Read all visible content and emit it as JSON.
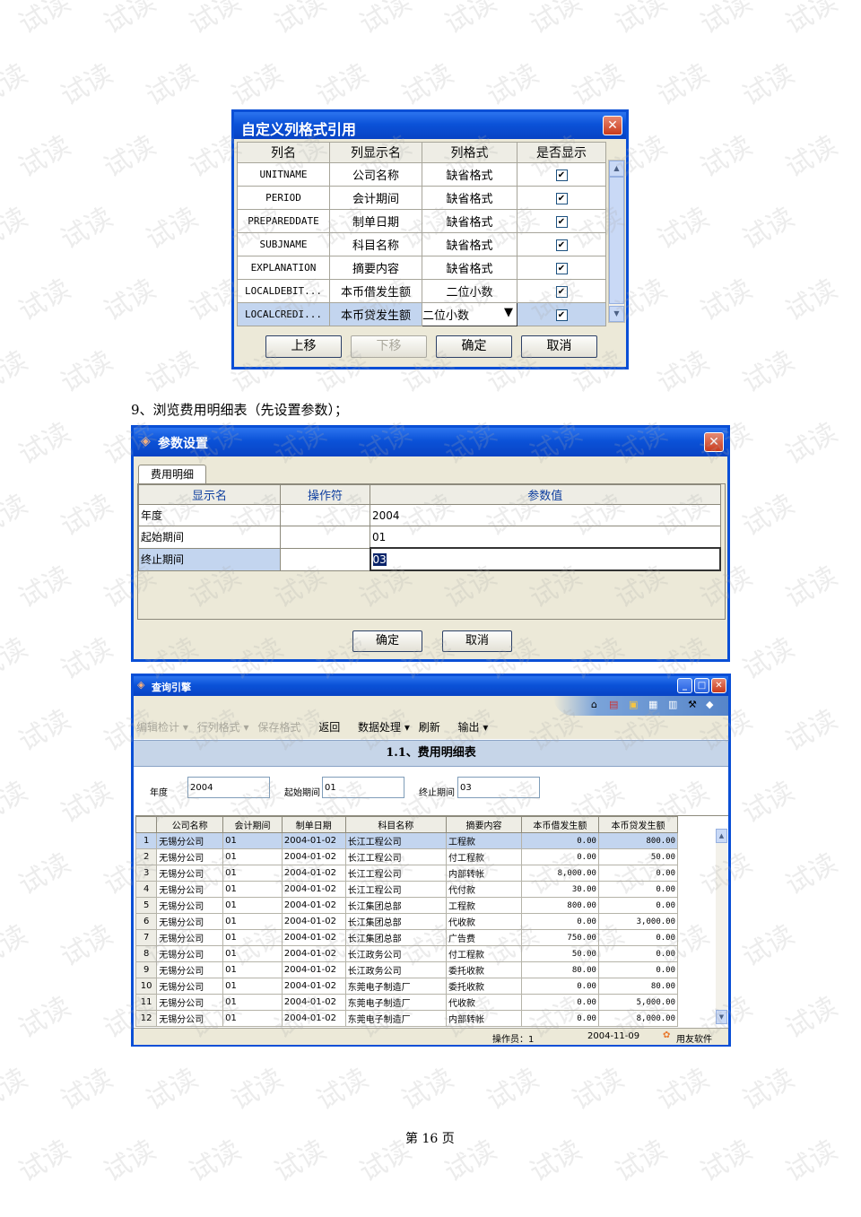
{
  "dialog1": {
    "title": "自定义列格式引用",
    "headers": [
      "列名",
      "列显示名",
      "列格式",
      "是否显示"
    ],
    "rows": [
      {
        "name": "UNITNAME",
        "display": "公司名称",
        "format": "缺省格式",
        "show": "✔"
      },
      {
        "name": "PERIOD",
        "display": "会计期间",
        "format": "缺省格式",
        "show": "✔"
      },
      {
        "name": "PREPAREDDATE",
        "display": "制单日期",
        "format": "缺省格式",
        "show": "✔"
      },
      {
        "name": "SUBJNAME",
        "display": "科目名称",
        "format": "缺省格式",
        "show": "✔"
      },
      {
        "name": "EXPLANATION",
        "display": "摘要内容",
        "format": "缺省格式",
        "show": "✔"
      },
      {
        "name": "LOCALDEBIT...",
        "display": "本币借发生额",
        "format": "二位小数",
        "show": "✔"
      },
      {
        "name": "LOCALCREDI...",
        "display": "本币贷发生额",
        "format": "二位小数",
        "show": "✔"
      }
    ],
    "buttons": {
      "up": "上移",
      "down": "下移",
      "ok": "确定",
      "cancel": "取消"
    }
  },
  "caption": "9、浏览费用明细表（先设置参数）；",
  "dialog2": {
    "title": "参数设置",
    "tab": "费用明细",
    "headers": [
      "显示名",
      "操作符",
      "参数值"
    ],
    "rows": [
      {
        "name": "年度",
        "op": "",
        "value": "2004"
      },
      {
        "name": "起始期间",
        "op": "",
        "value": "01"
      },
      {
        "name": "终止期间",
        "op": "",
        "value": "03"
      }
    ],
    "buttons": {
      "ok": "确定",
      "cancel": "取消"
    }
  },
  "query": {
    "title": "查询引擎",
    "menu": [
      "编辑检计 ▾",
      "行列格式 ▾",
      "保存格式",
      "返回",
      "数据处理 ▾",
      "刷新",
      "输出 ▾"
    ],
    "report_title": "1.1、费用明细表",
    "filters": {
      "year_label": "年度",
      "year": "2004",
      "start_label": "起始期间",
      "start": "01",
      "end_label": "终止期间",
      "end": "03"
    },
    "headers": [
      "公司名称",
      "会计期间",
      "制单日期",
      "科目名称",
      "摘要内容",
      "本币借发生额",
      "本币贷发生额"
    ],
    "rows": [
      [
        "1",
        "无锡分公司",
        "01",
        "2004-01-02",
        "长江工程公司",
        "工程款",
        "0.00",
        "800.00"
      ],
      [
        "2",
        "无锡分公司",
        "01",
        "2004-01-02",
        "长江工程公司",
        "付工程款",
        "0.00",
        "50.00"
      ],
      [
        "3",
        "无锡分公司",
        "01",
        "2004-01-02",
        "长江工程公司",
        "内部转帐",
        "8,000.00",
        "0.00"
      ],
      [
        "4",
        "无锡分公司",
        "01",
        "2004-01-02",
        "长江工程公司",
        "代付款",
        "30.00",
        "0.00"
      ],
      [
        "5",
        "无锡分公司",
        "01",
        "2004-01-02",
        "长江集团总部",
        "工程款",
        "800.00",
        "0.00"
      ],
      [
        "6",
        "无锡分公司",
        "01",
        "2004-01-02",
        "长江集团总部",
        "代收款",
        "0.00",
        "3,000.00"
      ],
      [
        "7",
        "无锡分公司",
        "01",
        "2004-01-02",
        "长江集团总部",
        "广告费",
        "750.00",
        "0.00"
      ],
      [
        "8",
        "无锡分公司",
        "01",
        "2004-01-02",
        "长江政务公司",
        "付工程款",
        "50.00",
        "0.00"
      ],
      [
        "9",
        "无锡分公司",
        "01",
        "2004-01-02",
        "长江政务公司",
        "委托收款",
        "80.00",
        "0.00"
      ],
      [
        "10",
        "无锡分公司",
        "01",
        "2004-01-02",
        "东莞电子制造厂",
        "委托收款",
        "0.00",
        "80.00"
      ],
      [
        "11",
        "无锡分公司",
        "01",
        "2004-01-02",
        "东莞电子制造厂",
        "代收款",
        "0.00",
        "5,000.00"
      ],
      [
        "12",
        "无锡分公司",
        "01",
        "2004-01-02",
        "东莞电子制造厂",
        "内部转帐",
        "0.00",
        "8,000.00"
      ]
    ],
    "status": {
      "operator": "操作员：1",
      "date": "2004-11-09",
      "brand": "用友软件"
    }
  },
  "footer": "第 16 页",
  "watermark": "试读"
}
